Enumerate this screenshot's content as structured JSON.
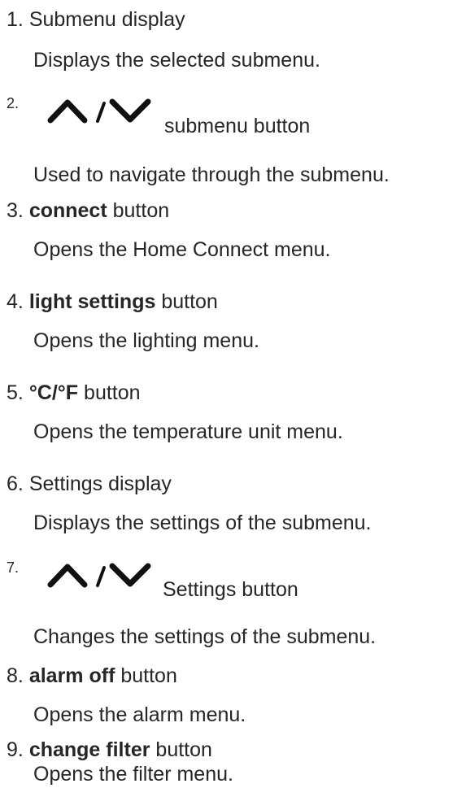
{
  "items": [
    {
      "number": "1.",
      "label": "Submenu display",
      "description": "Displays the selected submenu."
    },
    {
      "number": "2.",
      "icon": "up-down-chevron-icon",
      "separator": "/",
      "label": "submenu button",
      "description": "Used to navigate through the submenu."
    },
    {
      "number": "3.",
      "bold": "connect",
      "label": "button",
      "description": "Opens the Home Connect menu."
    },
    {
      "number": "4.",
      "bold": "light settings",
      "label": "button",
      "description": "Opens the lighting menu."
    },
    {
      "number": "5.",
      "bold": "°C/°F",
      "label": "button",
      "description": "Opens the temperature unit menu."
    },
    {
      "number": "6.",
      "label": "Settings display",
      "description": "Displays the settings of the submenu."
    },
    {
      "number": "7.",
      "icon": "up-down-chevron-icon",
      "separator": "/",
      "label": "Settings button",
      "description": "Changes the settings of the submenu."
    },
    {
      "number": "8.",
      "bold": "alarm off",
      "label": "button",
      "description": "Opens the alarm menu."
    },
    {
      "number": "9.",
      "bold": "change filter",
      "label": "button",
      "description": "Opens the filter menu."
    }
  ]
}
